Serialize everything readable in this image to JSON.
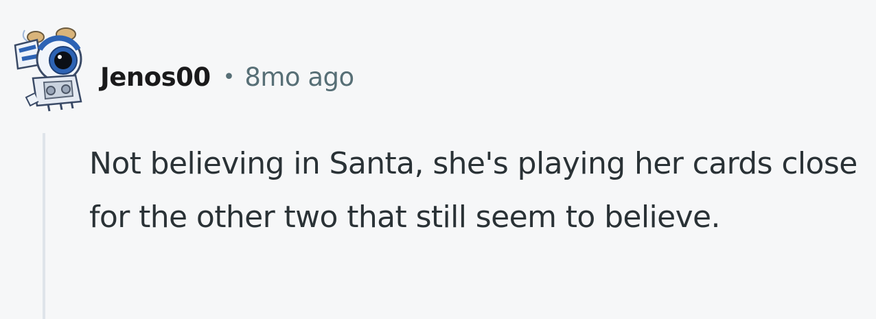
{
  "comment": {
    "avatar_icon": "robot-snoo-avatar-icon",
    "username": "Jenos00",
    "separator": "•",
    "timestamp": "8mo ago",
    "body": "Not believing in Santa, she's playing her cards close for the other two that still seem to believe."
  },
  "colors": {
    "background": "#f6f7f8",
    "username": "#1a1a1b",
    "meta": "#576f76",
    "body_text": "#2a3236",
    "thread_line": "#dfe4ea",
    "avatar_blue": "#2d63b4"
  }
}
